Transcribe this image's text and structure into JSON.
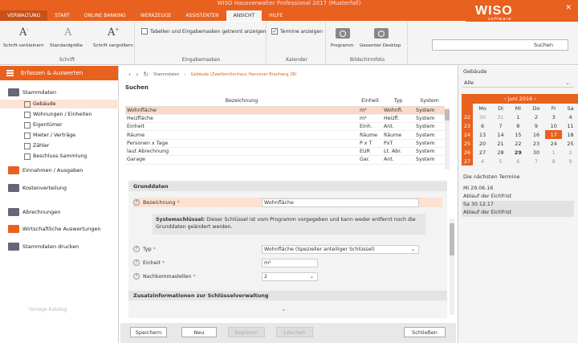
{
  "window": {
    "title": "WISO Hausverwalter Professional 2017 (Musterfall)"
  },
  "menu": [
    "Verwaltung",
    "Start",
    "Online Banking",
    "Werkzeuge",
    "Assistenten",
    "Ansicht",
    "Hilfe"
  ],
  "logo": {
    "name": "WISO",
    "sub": "software"
  },
  "ribbon": {
    "schrift": {
      "label": "Schrift",
      "buttons": [
        "Schrift verkleinern",
        "Standardgröße",
        "Schrift vergrößern"
      ]
    },
    "eingabemasken": {
      "label": "Eingabemasken",
      "checkbox": "Tabellen und Eingabemasken getrennt anzeigen",
      "checked": false
    },
    "kalender": {
      "label": "Kalender",
      "checkbox": "Termine anzeigen",
      "checked": true
    },
    "bildschirmfoto": {
      "label": "Bildschirmfoto",
      "buttons": [
        "Programm",
        "Gesamter Desktop"
      ]
    },
    "search": {
      "label": "Suchen"
    }
  },
  "sidebar": {
    "header": "Erfassen & Auswerten",
    "items": [
      "Stammdaten",
      "Einnahmen / Ausgaben",
      "Kostenverteilung",
      "Abrechnungen",
      "Wirtschaftliche Auswertungen",
      "Stammdaten drucken"
    ],
    "subitems": [
      "Gebäude",
      "Wohnungen / Einheiten",
      "Eigentümer",
      "Mieter / Verträge",
      "Zähler",
      "Beschluss-Sammlung"
    ],
    "footer": "Vorlage Katalog"
  },
  "breadcrumb": {
    "root": "Stammdaten",
    "path": "Gebäude (Zweifamilienhaus Hannover Brauhang 28)"
  },
  "suchen": {
    "title": "Suchen",
    "columns": [
      "Bezeichnung",
      "Einheit",
      "Typ",
      "System"
    ],
    "rows": [
      [
        "Wohnfläche",
        "m²",
        "Wohnfl.",
        "System"
      ],
      [
        "Heizfläche",
        "m²",
        "Heizfl.",
        "System"
      ],
      [
        "Einheit",
        "Einh.",
        "Ant.",
        "System"
      ],
      [
        "Räume",
        "Räume",
        "Räume",
        "System"
      ],
      [
        "Personen x Tage",
        "P x T",
        "PxT",
        "System"
      ],
      [
        "laut Abrechnung",
        "EUR",
        "Lt. Abr.",
        "System"
      ],
      [
        "Garage",
        "Gar.",
        "Ant.",
        "System"
      ]
    ]
  },
  "grunddaten": {
    "title": "Grunddaten",
    "bezeichnung": {
      "label": "Bezeichnung",
      "value": "Wohnfläche"
    },
    "info_bold": "Systemschlüssel:",
    "info": " Dieser Schlüssel ist vom Programm vorgegeben und kann weder entfernt noch die Grunddaten geändert werden.",
    "typ": {
      "label": "Typ",
      "value": "Wohnfläche (Spezieller anteiliger Schlüssel)"
    },
    "einheit": {
      "label": "Einheit",
      "value": "m²"
    },
    "nachkomma": {
      "label": "Nachkommastellen",
      "value": "2"
    }
  },
  "zusatz": {
    "title": "Zusatzinformationen zur Schlüsselverwaltung"
  },
  "buttons": {
    "speichern": "Speichern",
    "neu": "Neu",
    "kopieren": "Kopieren",
    "loeschen": "Löschen",
    "schliessen": "Schließen"
  },
  "right": {
    "gebaeude_label": "Gebäude",
    "gebaeude_value": "Alle",
    "month": "Juni   2016",
    "weekdays": [
      "Mo",
      "Di",
      "Mi",
      "Do",
      "Fr",
      "Sa"
    ],
    "weeks": [
      [
        "22",
        "30",
        "31",
        "1",
        "2",
        "3",
        "4"
      ],
      [
        "23",
        "6",
        "7",
        "8",
        "9",
        "10",
        "11"
      ],
      [
        "24",
        "13",
        "14",
        "15",
        "16",
        "17",
        "18"
      ],
      [
        "25",
        "20",
        "21",
        "22",
        "23",
        "24",
        "25"
      ],
      [
        "26",
        "27",
        "28",
        "29",
        "30",
        "1",
        "2"
      ],
      [
        "27",
        "4",
        "5",
        "6",
        "7",
        "8",
        "9"
      ]
    ],
    "termine_title": "Die nächsten Termine",
    "termine": [
      "Mi 29.06.16",
      "Ablauf der Eichfrist",
      "Sa 30.12.17",
      "Ablauf der Eichfrist"
    ]
  },
  "colors": {
    "accent": "#e8611f",
    "selected_row": "#fbd9c4"
  }
}
